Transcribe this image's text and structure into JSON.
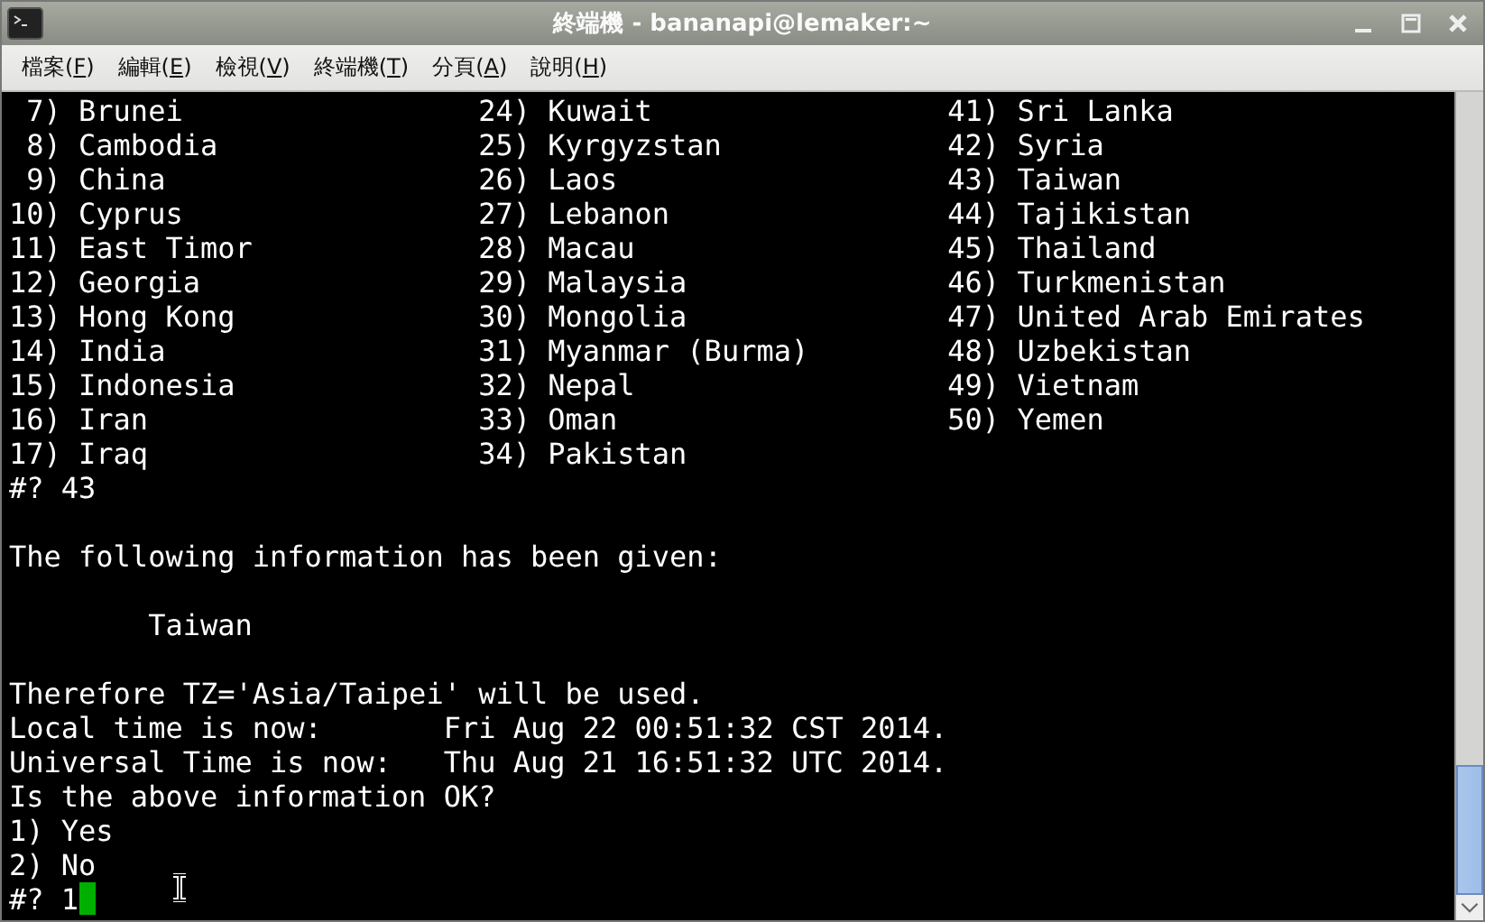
{
  "window": {
    "title": "終端機 - bananapi@lemaker:~"
  },
  "menu": [
    {
      "label": "檔案(F)"
    },
    {
      "label": "編輯(E)"
    },
    {
      "label": "檢視(V)"
    },
    {
      "label": "終端機(T)"
    },
    {
      "label": "分頁(A)"
    },
    {
      "label": "說明(H)"
    }
  ],
  "terminal": {
    "list_rows": [
      [
        " 7) Brunei",
        "24) Kuwait",
        "41) Sri Lanka"
      ],
      [
        " 8) Cambodia",
        "25) Kyrgyzstan",
        "42) Syria"
      ],
      [
        " 9) China",
        "26) Laos",
        "43) Taiwan"
      ],
      [
        "10) Cyprus",
        "27) Lebanon",
        "44) Tajikistan"
      ],
      [
        "11) East Timor",
        "28) Macau",
        "45) Thailand"
      ],
      [
        "12) Georgia",
        "29) Malaysia",
        "46) Turkmenistan"
      ],
      [
        "13) Hong Kong",
        "30) Mongolia",
        "47) United Arab Emirates"
      ],
      [
        "14) India",
        "31) Myanmar (Burma)",
        "48) Uzbekistan"
      ],
      [
        "15) Indonesia",
        "32) Nepal",
        "49) Vietnam"
      ],
      [
        "16) Iran",
        "33) Oman",
        "50) Yemen"
      ],
      [
        "17) Iraq",
        "34) Pakistan"
      ]
    ],
    "lines": [
      {
        "kind": "text",
        "text": "#? 43"
      },
      {
        "kind": "blank"
      },
      {
        "kind": "text",
        "text": "The following information has been given:"
      },
      {
        "kind": "blank"
      },
      {
        "kind": "text",
        "text": "        Taiwan"
      },
      {
        "kind": "blank"
      },
      {
        "kind": "text",
        "text": "Therefore TZ='Asia/Taipei' will be used."
      },
      {
        "kind": "text",
        "text": "Local time is now:       Fri Aug 22 00:51:32 CST 2014."
      },
      {
        "kind": "text",
        "text": "Universal Time is now:   Thu Aug 21 16:51:32 UTC 2014."
      },
      {
        "kind": "text",
        "text": "Is the above information OK?"
      },
      {
        "kind": "text",
        "text": "1) Yes"
      },
      {
        "kind": "text",
        "text": "2) No"
      },
      {
        "kind": "prompt",
        "text": "#? 1"
      }
    ]
  }
}
